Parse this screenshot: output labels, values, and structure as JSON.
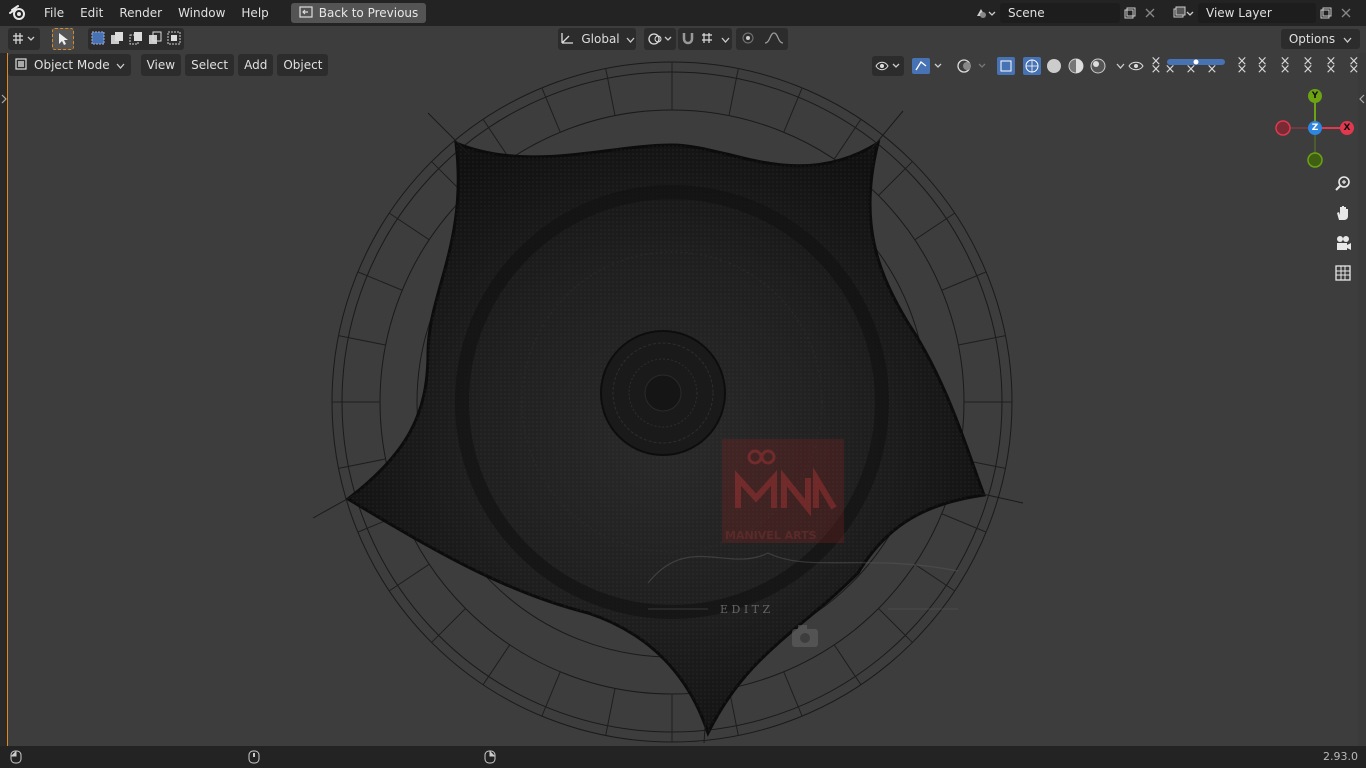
{
  "menubar": {
    "items": [
      "File",
      "Edit",
      "Render",
      "Window",
      "Help"
    ],
    "back_button": "Back to Previous"
  },
  "scene": {
    "label": "Scene",
    "view_layer": "View Layer"
  },
  "toolbar": {
    "transform_orientation": "Global",
    "options_label": "Options"
  },
  "viewport_header": {
    "mode": "Object Mode",
    "menus": [
      "View",
      "Select",
      "Add",
      "Object"
    ]
  },
  "gizmo": {
    "y": "Y",
    "x": "X",
    "z": "Z"
  },
  "watermark": {
    "brand": "MANIVEL ARTS",
    "letters": "E D I T Z"
  },
  "status": {
    "version": "2.93.0"
  },
  "colors": {
    "accent_blue": "#4772b3",
    "axis_x": "#e0384f",
    "axis_y": "#6da313",
    "axis_z": "#2e86e0",
    "active_outline": "#e08a1e"
  }
}
